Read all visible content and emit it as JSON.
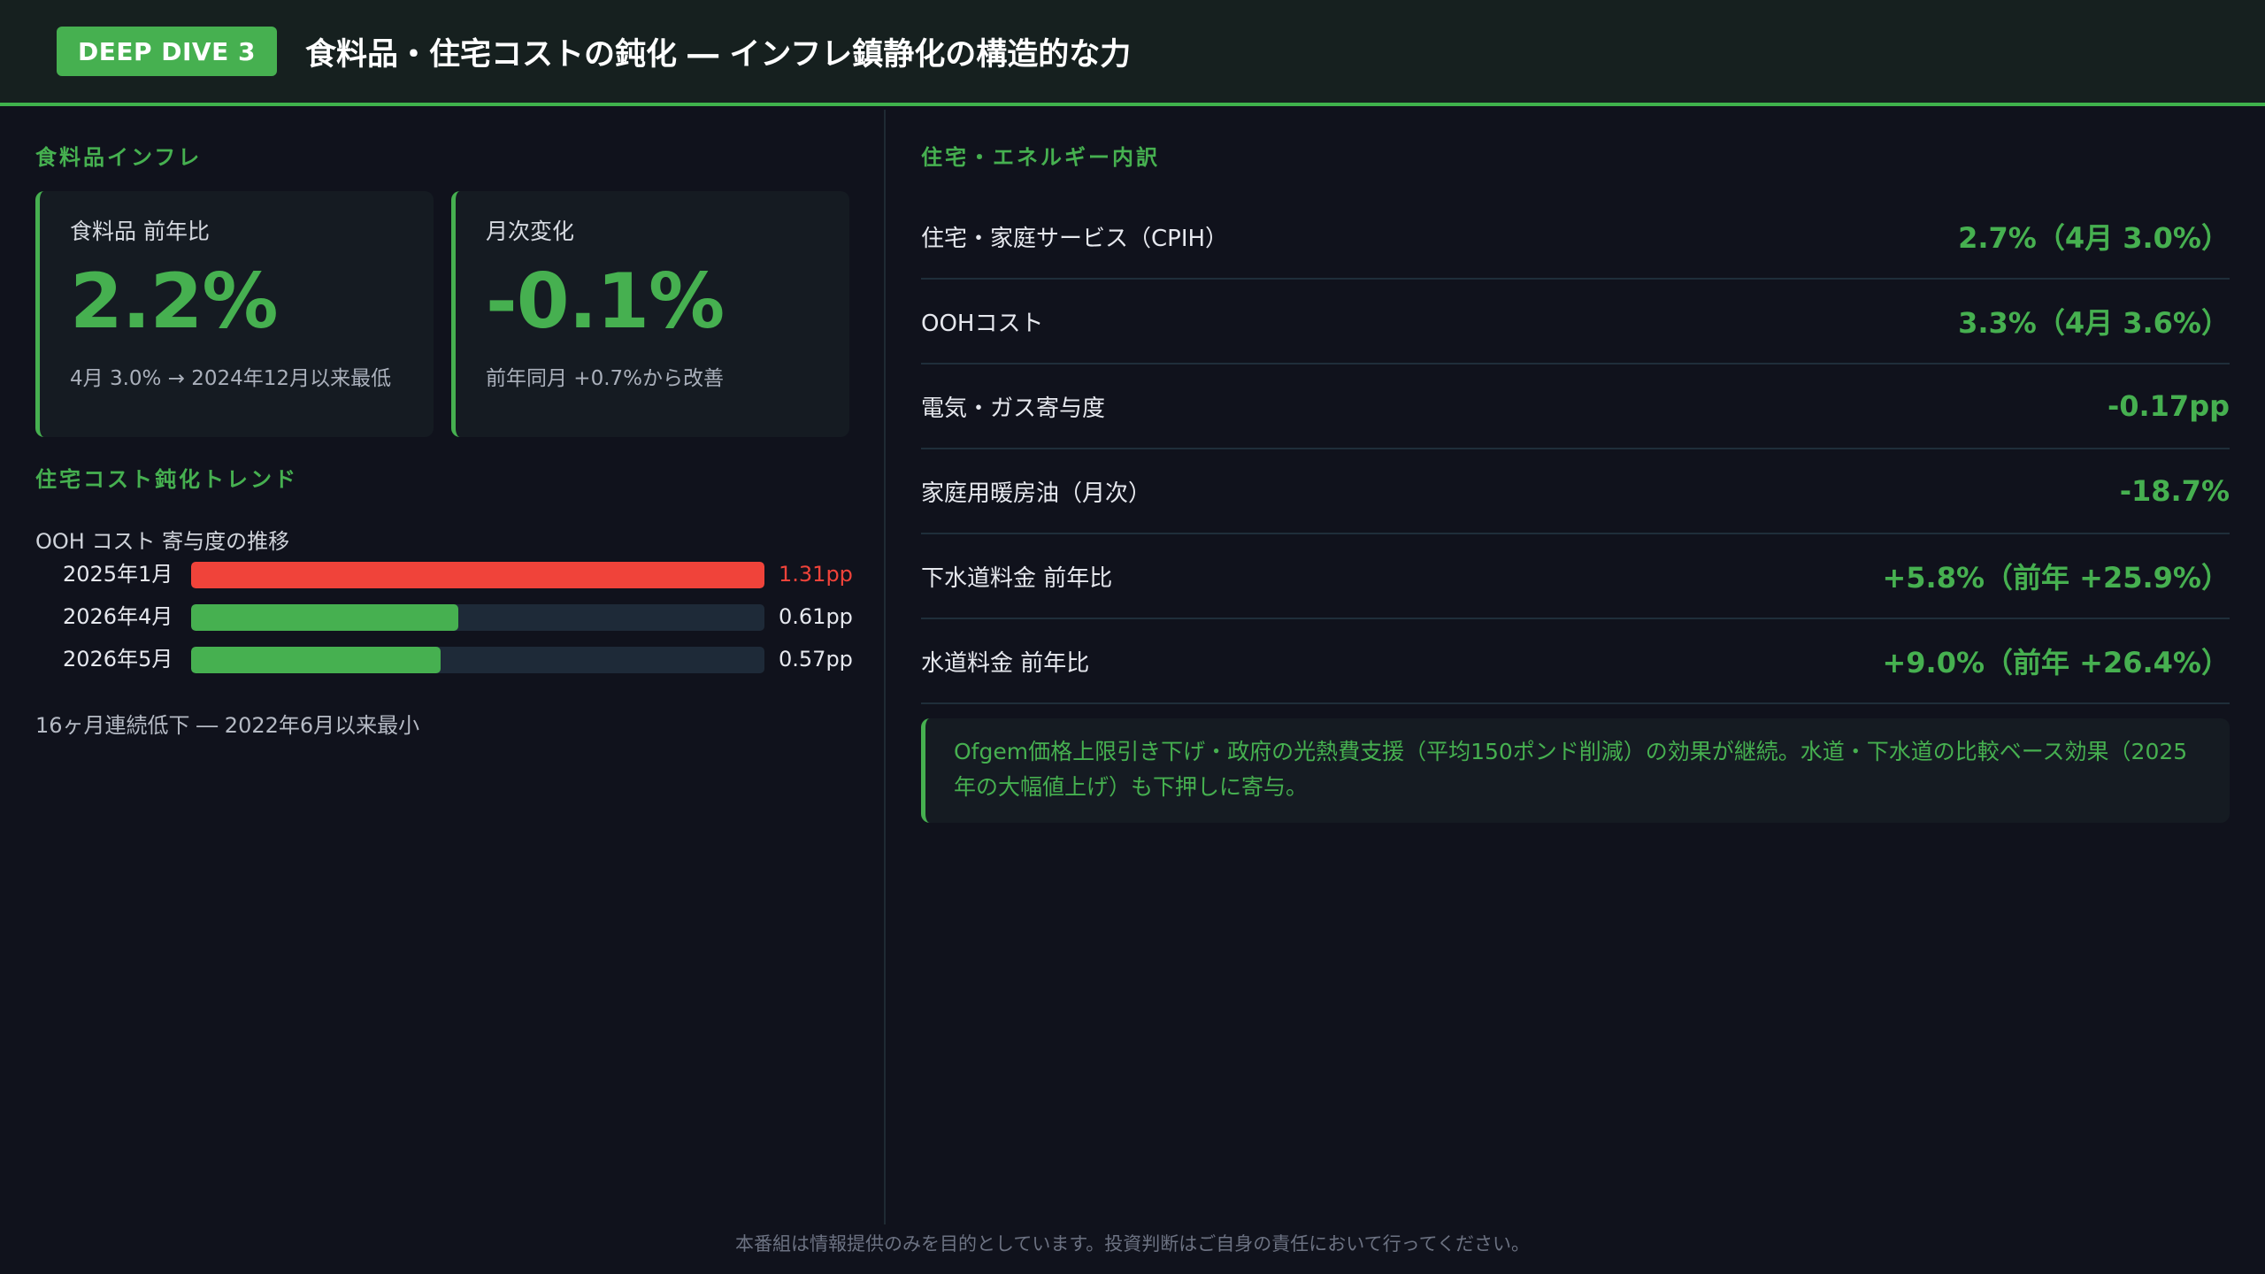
{
  "header": {
    "badge": "DEEP DIVE 3",
    "title": "食料品・住宅コストの鈍化 ― インフレ鎮静化の構造的な力"
  },
  "food": {
    "section_title": "食料品インフレ",
    "cards": [
      {
        "label": "食料品 前年比",
        "value": "2.2%",
        "sub": "4月 3.0% → 2024年12月以来最低"
      },
      {
        "label": "月次変化",
        "value": "-0.1%",
        "sub": "前年同月 +0.7%から改善"
      }
    ]
  },
  "housing_trend": {
    "section_title": "住宅コスト鈍化トレンド",
    "caption": "OOH コスト 寄与度の推移",
    "bars": [
      {
        "label": "2025年1月",
        "value": 1.31,
        "display": "1.31pp",
        "color": "#f0433a"
      },
      {
        "label": "2026年4月",
        "value": 0.61,
        "display": "0.61pp",
        "color": "#46b050"
      },
      {
        "label": "2026年5月",
        "value": 0.57,
        "display": "0.57pp",
        "color": "#46b050"
      }
    ],
    "scale_max": 1.31,
    "note": "16ヶ月連続低下 ― 2022年6月以来最小"
  },
  "breakdown": {
    "section_title": "住宅・エネルギー内訳",
    "rows": [
      {
        "label": "住宅・家庭サービス（CPIH）",
        "value": "2.7%（4月 3.0%）"
      },
      {
        "label": "OOHコスト",
        "value": "3.3%（4月 3.6%）"
      },
      {
        "label": "電気・ガス寄与度",
        "value": "-0.17pp"
      },
      {
        "label": "家庭用暖房油（月次）",
        "value": "-18.7%"
      },
      {
        "label": "下水道料金 前年比",
        "value": "+5.8%（前年 +25.9%）"
      },
      {
        "label": "水道料金 前年比",
        "value": "+9.0%（前年 +26.4%）"
      }
    ],
    "note": "Ofgem価格上限引き下げ・政府の光熱費支援（平均150ポンド削減）の効果が継続。水道・下水道の比較ベース効果（2025年の大幅値上げ）も下押しに寄与。"
  },
  "footer": "本番組は情報提供のみを目的としています。投資判断はご自身の責任において行ってください。",
  "colors": {
    "accent": "#46b050",
    "alert": "#f0433a",
    "background": "#10121c"
  }
}
